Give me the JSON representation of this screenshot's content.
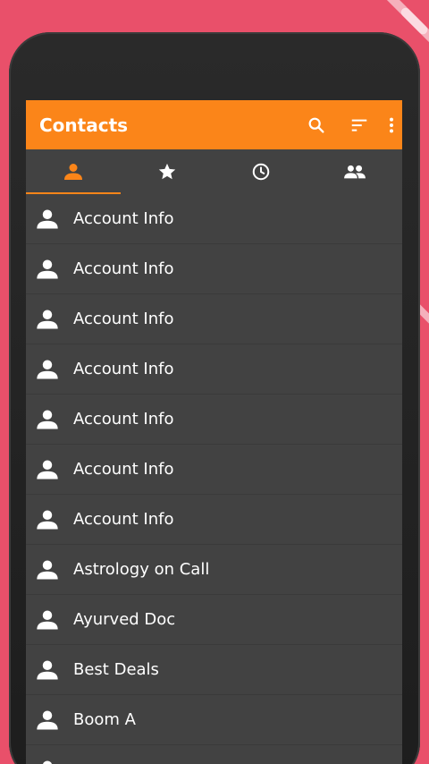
{
  "appbar": {
    "title": "Contacts",
    "actions": [
      {
        "icon": "search-icon"
      },
      {
        "icon": "sort-icon"
      },
      {
        "icon": "more-vert-icon"
      }
    ]
  },
  "tabs": [
    {
      "icon": "person-icon",
      "selected": true
    },
    {
      "icon": "star-icon",
      "selected": false
    },
    {
      "icon": "clock-icon",
      "selected": false
    },
    {
      "icon": "group-icon",
      "selected": false
    }
  ],
  "contacts": [
    {
      "name": "Account Info"
    },
    {
      "name": "Account Info"
    },
    {
      "name": "Account Info"
    },
    {
      "name": "Account Info"
    },
    {
      "name": "Account Info"
    },
    {
      "name": "Account Info"
    },
    {
      "name": "Account Info"
    },
    {
      "name": "Astrology on Call"
    },
    {
      "name": "Ayurved Doc"
    },
    {
      "name": "Best Deals"
    },
    {
      "name": "Boom A"
    },
    {
      "name": ""
    }
  ],
  "colors": {
    "accent": "#fb8519",
    "background": "#e9506a",
    "list_bg": "#424242"
  }
}
